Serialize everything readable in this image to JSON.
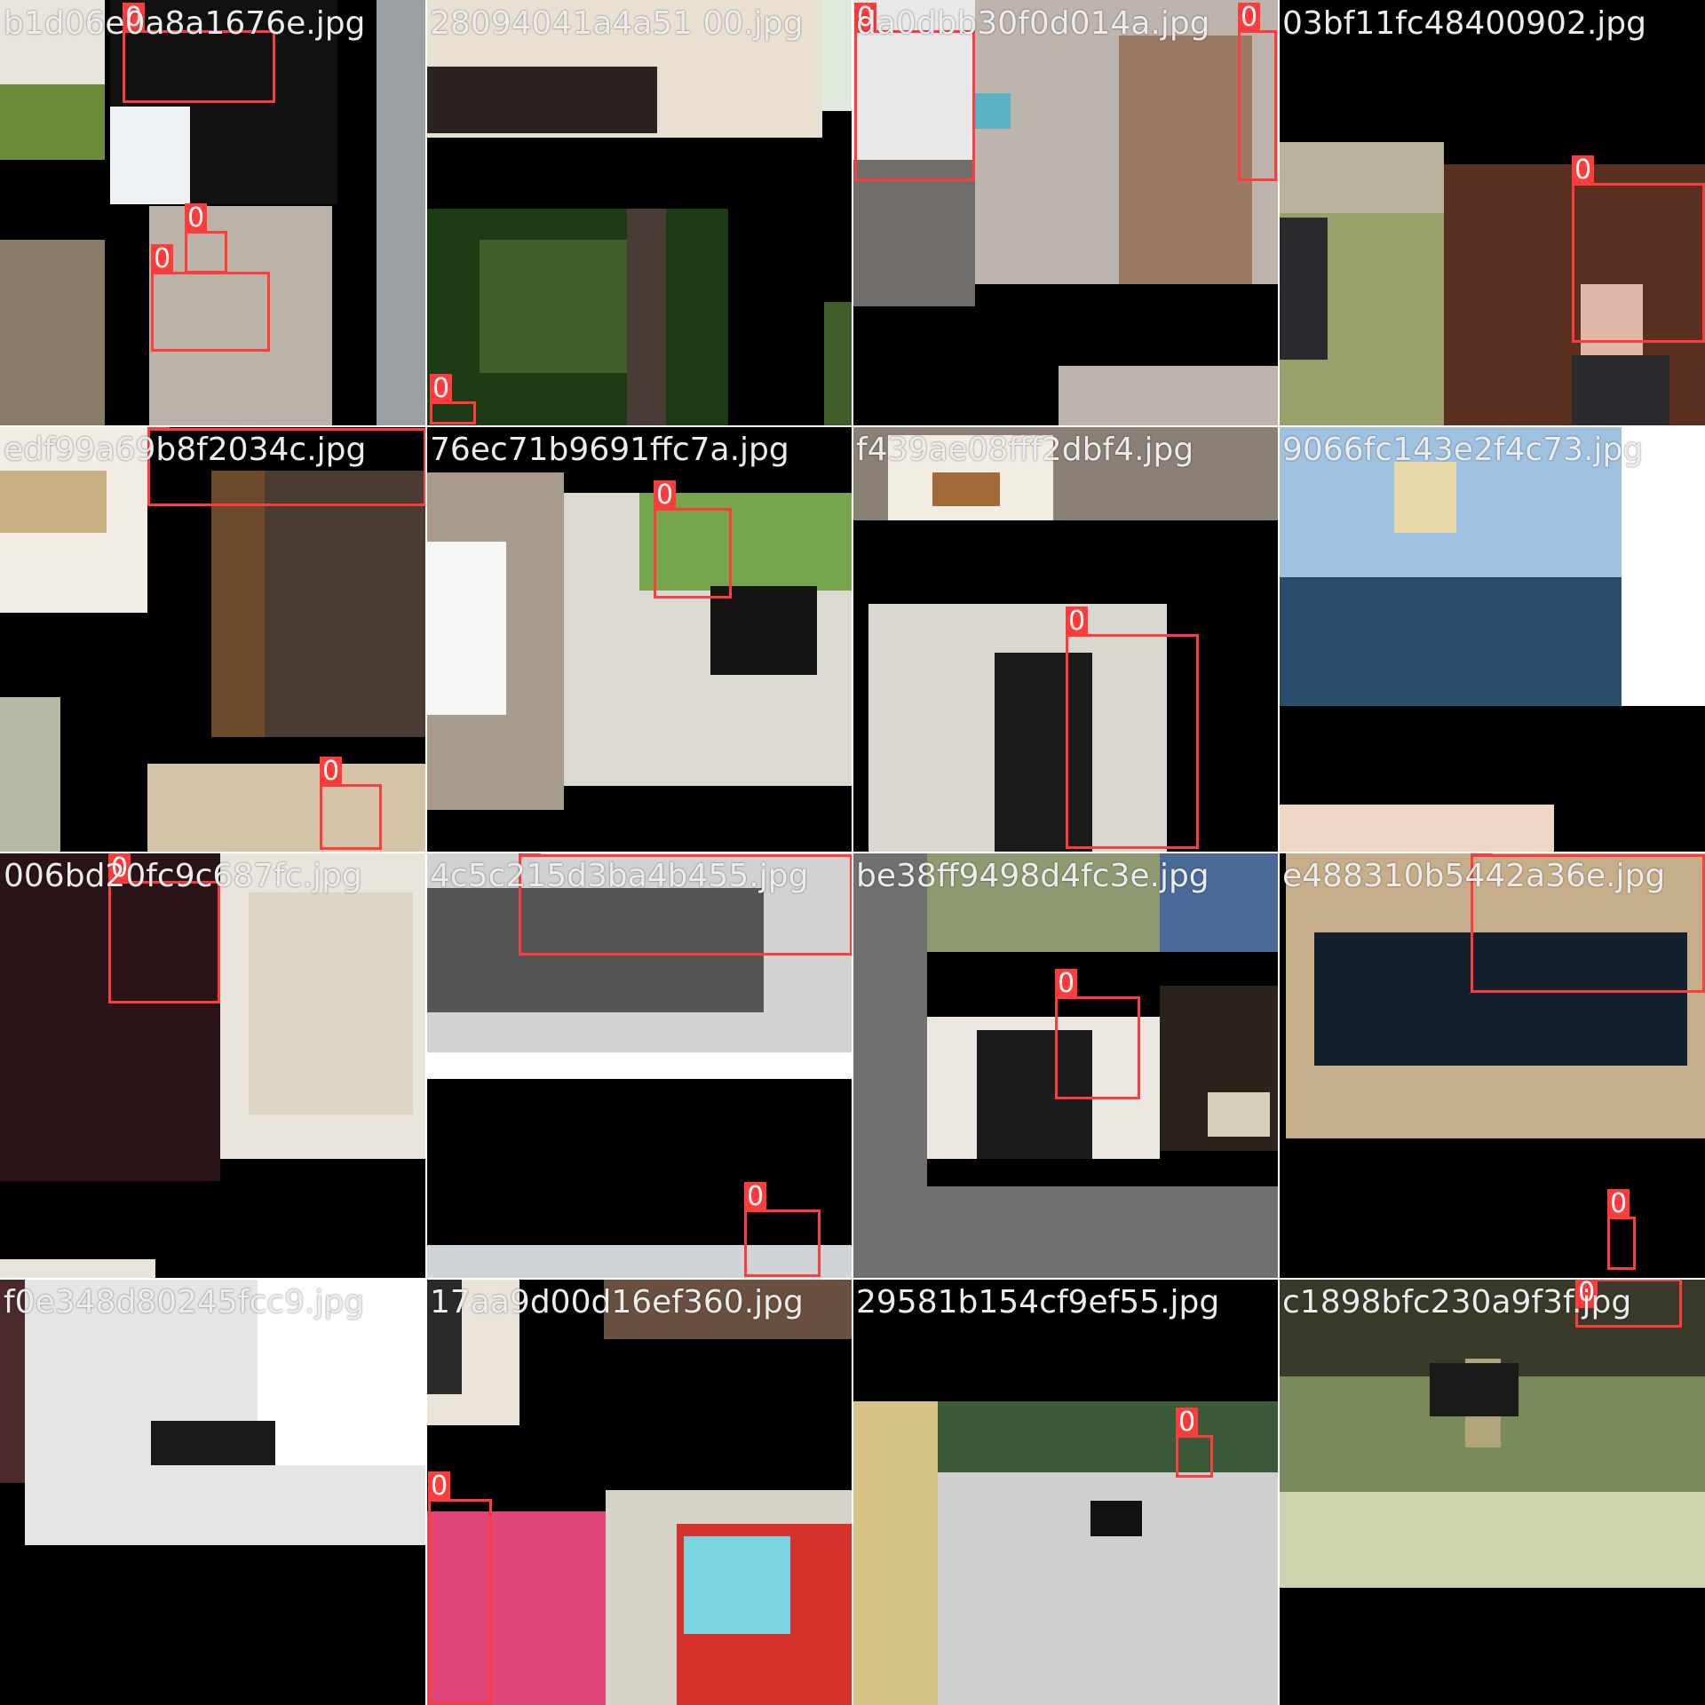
{
  "mosaic": {
    "class_label": "0",
    "box_color": "#ff3b3b",
    "tiles": [
      {
        "id": "t00",
        "filename": "b1d06e0a8a1676e.jpg",
        "scene": [
          "#e8e4dc",
          "#d9dcc4",
          "#6d8c3a",
          "#8a7a68",
          "#111111",
          "#eef2f5",
          "#9aa0a4",
          "#b8b2a8"
        ]
      },
      {
        "id": "t01",
        "filename": "28094041a4a51 00.jpg",
        "scene": [
          "#e9e0d2",
          "#2a2320",
          "#c8c65a",
          "#1d3b14",
          "#3f5e2a",
          "#4a3c36",
          "#dfe9dd"
        ]
      },
      {
        "id": "t02",
        "filename": "da0dbb30f0d014a.jpg",
        "scene": [
          "#e8e8e8",
          "#6f6c6a",
          "#9a7a62",
          "#5ab2c2",
          "#bdb4ad"
        ]
      },
      {
        "id": "t03",
        "filename": "03bf11fc48400902.jpg",
        "scene": [
          "#b9b29a",
          "#9aa06a",
          "#5a3020",
          "#2c2a2e",
          "#e0b8a8"
        ]
      },
      {
        "id": "t10",
        "filename": "edf99a69b8f2034c.jpg",
        "scene": [
          "#f1ece4",
          "#c9b083",
          "#4a3c32",
          "#6e4a2c",
          "#d5c4a8",
          "#b7b7a5"
        ]
      },
      {
        "id": "t11",
        "filename": "76ec71b9691ffc7a.jpg",
        "scene": [
          "#a89a8c",
          "#f6f6f4",
          "#2a2a2a",
          "#dcd8d2",
          "#76a54e",
          "#151515"
        ]
      },
      {
        "id": "t12",
        "filename": "f439ae08fff2dbf4.jpg",
        "scene": [
          "#f1ede2",
          "#a06a3a",
          "#1a1a1a",
          "#dad6d0",
          "#8a8076",
          "#c0392b"
        ]
      },
      {
        "id": "t13",
        "filename": "9066fc143e2f4c73.jpg",
        "scene": [
          "#2a4d6e",
          "#9fc2e1",
          "#e8d9a8",
          "#ffffff",
          "#efd6c4"
        ]
      },
      {
        "id": "t20",
        "filename": "006bd20fc9c687fc.jpg",
        "scene": [
          "#2a1418",
          "#ddd6c5",
          "#f0f0f0",
          "#3a3030",
          "#e9e4dc"
        ]
      },
      {
        "id": "t21",
        "filename": "4c5c215d3ba4b455.jpg",
        "scene": [
          "#d2d2d2",
          "#555555",
          "#e6e6e6",
          "#ffffff",
          "#cfd4d8"
        ]
      },
      {
        "id": "t22",
        "filename": "be38ff9498d4fc3e.jpg",
        "scene": [
          "#707070",
          "#8f9a72",
          "#4a6a9a",
          "#ece7e0",
          "#1c1c1c",
          "#2a241c",
          "#d6cfb8"
        ]
      },
      {
        "id": "t23",
        "filename": "e488310b5442a36e.jpg",
        "scene": [
          "#c7ae8a",
          "#15202f",
          "#000000"
        ]
      },
      {
        "id": "t30",
        "filename": "f0e348d80245fcc9.jpg",
        "scene": [
          "#ffffff",
          "#1a1a1a",
          "#e5e5e5",
          "#4a2a2a"
        ]
      },
      {
        "id": "t31",
        "filename": "17aa9d00d16ef360.jpg",
        "scene": [
          "#e9e3d8",
          "#6a5040",
          "#2a2a2a",
          "#e0457a",
          "#d5d2c8",
          "#d6322c",
          "#7ad4e0"
        ]
      },
      {
        "id": "t32",
        "filename": "29581b154cf9ef55.jpg",
        "scene": [
          "#cfcfcf",
          "#8fa0a0",
          "#3a5a3a",
          "#d7c38a",
          "#111111",
          "#000000"
        ]
      },
      {
        "id": "t33",
        "filename": "c1898bfc230a9f3f.jpg",
        "scene": [
          "#7a8a5a",
          "#b0a57a",
          "#3a3a2a",
          "#9aa88a",
          "#1a1a1a",
          "#cfd4ae"
        ]
      }
    ]
  }
}
